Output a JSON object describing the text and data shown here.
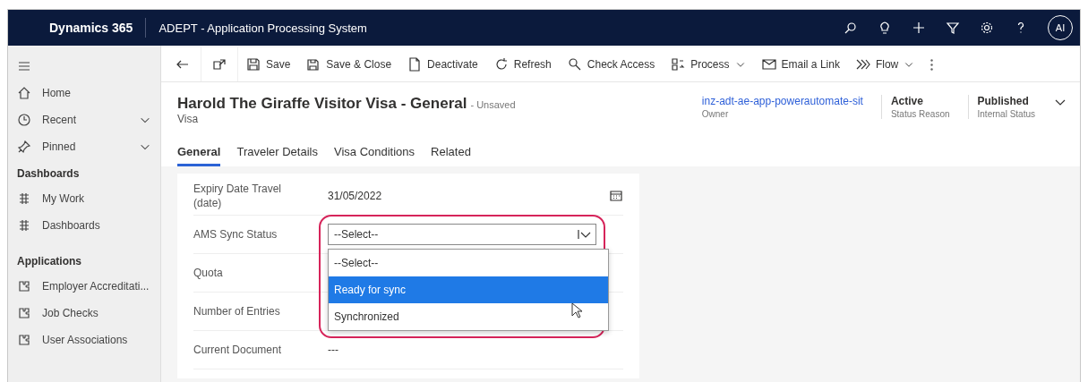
{
  "topbar": {
    "brand": "Dynamics 365",
    "app_title": "ADEPT - Application Processing System",
    "avatar": "AI"
  },
  "sidebar": {
    "items": [
      {
        "label": "Home",
        "kind": "home",
        "expandable": false
      },
      {
        "label": "Recent",
        "kind": "recent",
        "expandable": true
      },
      {
        "label": "Pinned",
        "kind": "pin",
        "expandable": true
      }
    ],
    "sections": [
      {
        "title": "Dashboards",
        "items": [
          {
            "label": "My Work",
            "kind": "dash"
          },
          {
            "label": "Dashboards",
            "kind": "dash"
          }
        ]
      },
      {
        "title": "Applications",
        "items": [
          {
            "label": "Employer Accreditati...",
            "kind": "app"
          },
          {
            "label": "Job Checks",
            "kind": "app"
          },
          {
            "label": "User Associations",
            "kind": "app"
          }
        ]
      }
    ]
  },
  "commands": [
    {
      "label": "Save",
      "kind": "save",
      "menu": false
    },
    {
      "label": "Save & Close",
      "kind": "saveclose",
      "menu": false
    },
    {
      "label": "Deactivate",
      "kind": "doc",
      "menu": false
    },
    {
      "label": "Refresh",
      "kind": "refresh",
      "menu": false
    },
    {
      "label": "Check Access",
      "kind": "search",
      "menu": false
    },
    {
      "label": "Process",
      "kind": "process",
      "menu": true
    },
    {
      "label": "Email a Link",
      "kind": "mail",
      "menu": false
    },
    {
      "label": "Flow",
      "kind": "flow",
      "menu": true
    }
  ],
  "record": {
    "title": "Harold The Giraffe Visitor Visa - General",
    "status": "- Unsaved",
    "entity": "Visa",
    "fields": [
      {
        "value": "inz-adt-ae-app-powerautomate-sit",
        "label": "Owner",
        "link": true
      },
      {
        "value": "Active",
        "label": "Status Reason",
        "link": false
      },
      {
        "value": "Published",
        "label": "Internal Status",
        "link": false
      }
    ]
  },
  "tabs": [
    {
      "label": "General",
      "selected": true
    },
    {
      "label": "Traveler Details",
      "selected": false
    },
    {
      "label": "Visa Conditions",
      "selected": false
    },
    {
      "label": "Related",
      "selected": false
    }
  ],
  "form": {
    "rows": [
      {
        "label": "Expiry Date Travel (date)",
        "value": "31/05/2022",
        "kind": "date"
      },
      {
        "label": "AMS Sync Status",
        "value": "--Select--",
        "kind": "select"
      },
      {
        "label": "Quota",
        "kind": "plain"
      },
      {
        "label": "Number of Entries",
        "kind": "plain"
      },
      {
        "label": "Current Document",
        "value": "---",
        "kind": "plain"
      }
    ],
    "dropdown": {
      "options": [
        {
          "label": "--Select--",
          "selected": false
        },
        {
          "label": "Ready for sync",
          "selected": true
        },
        {
          "label": "Synchronized",
          "selected": false
        }
      ]
    }
  }
}
